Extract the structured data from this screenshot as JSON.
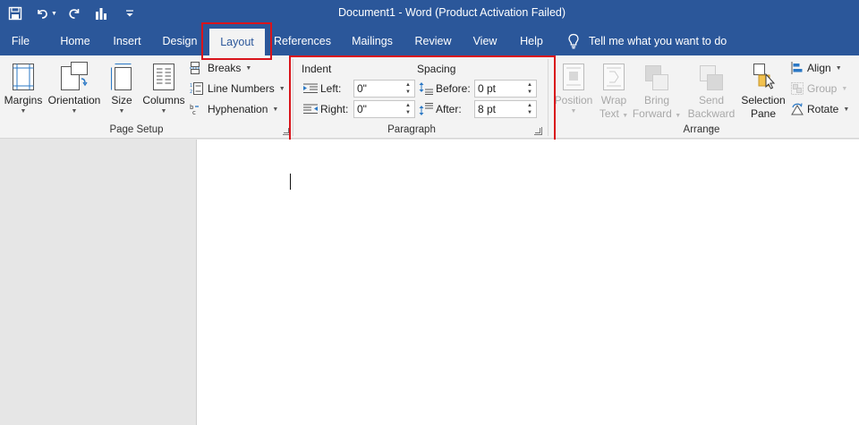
{
  "window": {
    "title": "Document1  -  Word (Product Activation Failed)"
  },
  "qat": {
    "icons": [
      "save-icon",
      "undo-icon",
      "redo-icon",
      "chart-icon",
      "customize-icon"
    ]
  },
  "tabs": [
    {
      "label": "File"
    },
    {
      "label": "Home"
    },
    {
      "label": "Insert"
    },
    {
      "label": "Design"
    },
    {
      "label": "Layout",
      "active": true
    },
    {
      "label": "References"
    },
    {
      "label": "Mailings"
    },
    {
      "label": "Review"
    },
    {
      "label": "View"
    },
    {
      "label": "Help"
    }
  ],
  "tell_me": {
    "label": "Tell me what you want to do",
    "icon": "lightbulb-icon"
  },
  "page_setup": {
    "group_label": "Page Setup",
    "margins": "Margins",
    "orientation": "Orientation",
    "size": "Size",
    "columns": "Columns",
    "breaks": "Breaks",
    "line_numbers": "Line Numbers",
    "hyphenation": "Hyphenation"
  },
  "paragraph": {
    "group_label": "Paragraph",
    "indent_heading": "Indent",
    "spacing_heading": "Spacing",
    "left_label": "Left:",
    "left_value": "0\"",
    "right_label": "Right:",
    "right_value": "0\"",
    "before_label": "Before:",
    "before_value": "0 pt",
    "after_label": "After:",
    "after_value": "8 pt"
  },
  "arrange": {
    "group_label": "Arrange",
    "position": "Position",
    "wrap_1": "Wrap",
    "wrap_2": "Text",
    "bring_1": "Bring",
    "bring_2": "Forward",
    "send_1": "Send",
    "send_2": "Backward",
    "selection_1": "Selection",
    "selection_2": "Pane",
    "align": "Align",
    "group": "Group",
    "rotate": "Rotate"
  },
  "colors": {
    "brand": "#2b579a",
    "highlight": "#d9141b",
    "ribbon_bg": "#f3f3f3"
  }
}
